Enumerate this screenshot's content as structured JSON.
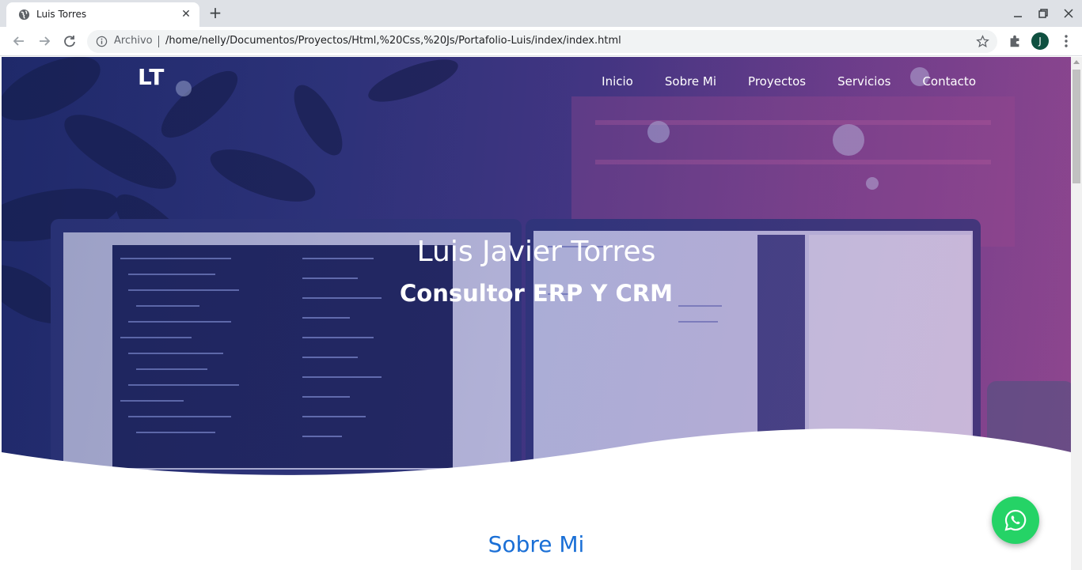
{
  "browser": {
    "tab_title": "Luis Torres",
    "new_tab_symbol": "+",
    "close_symbol": "✕",
    "security_label": "Archivo",
    "url": "/home/nelly/Documentos/Proyectos/Html,%20Css,%20Js/Portafolio-Luis/index/index.html",
    "profile_initial": "J"
  },
  "page": {
    "logo": "LT",
    "nav": [
      {
        "label": "Inicio"
      },
      {
        "label": "Sobre Mi"
      },
      {
        "label": "Proyectos"
      },
      {
        "label": "Servicios"
      },
      {
        "label": "Contacto"
      }
    ],
    "hero": {
      "name": "Luis Javier Torres",
      "role": "Consultor ERP Y CRM"
    },
    "about_title": "Sobre Mi"
  },
  "icons": {
    "whatsapp": "whatsapp-icon"
  },
  "colors": {
    "accent": "#1a6fd6",
    "whatsapp": "#25d366",
    "hero_dark": "#1f2a68",
    "hero_pink": "#8b4a8f"
  }
}
